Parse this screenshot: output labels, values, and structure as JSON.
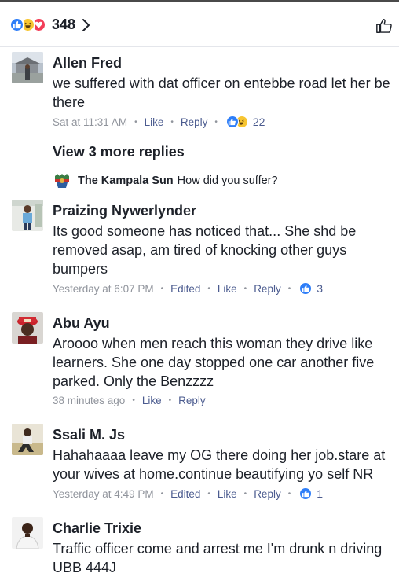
{
  "header": {
    "reactions": [
      "like-icon",
      "haha-icon",
      "love-icon"
    ],
    "reaction_count": "348"
  },
  "comments": [
    {
      "author": "Allen Fred",
      "text": "we suffered with dat officer on entebbe road let her be there",
      "time": "Sat at 11:31 AM",
      "edited": "",
      "like_label": "Like",
      "reply_label": "Reply",
      "reaction_count": "22"
    },
    {
      "author": "Praizing Nywerlynder",
      "text": "Its good someone has noticed that... She shd be removed asap, am tired of knocking other guys bumpers",
      "time": "Yesterday at 6:07 PM",
      "edited": "Edited",
      "like_label": "Like",
      "reply_label": "Reply",
      "reaction_count": "3"
    },
    {
      "author": "Abu Ayu",
      "text": "Aroooo when men reach this woman they drive like learners. She one day stopped one car another five parked. Only the Benzzzz",
      "time": "38 minutes ago",
      "like_label": "Like",
      "reply_label": "Reply"
    },
    {
      "author": "Ssali M. Js",
      "text": "Hahahaaaa leave my OG there doing her job.stare at your wives at home.continue beautifying yo self NR",
      "time": "Yesterday at 4:49 PM",
      "edited": "Edited",
      "like_label": "Like",
      "reply_label": "Reply",
      "reaction_count": "1"
    },
    {
      "author": "Charlie Trixie",
      "text": "Traffic officer come and arrest me I'm drunk n driving UBB 444J"
    }
  ],
  "thread": {
    "view_more_label": "View 3 more replies",
    "reply_author": "The Kampala Sun",
    "reply_text": "How did you suffer?"
  },
  "colors": {
    "like_blue": "#2e7ef8",
    "haha_yellow": "#f7c531",
    "love_red": "#f33e58",
    "meta_gray": "#90949c",
    "action_blue": "#4b5b8f"
  }
}
